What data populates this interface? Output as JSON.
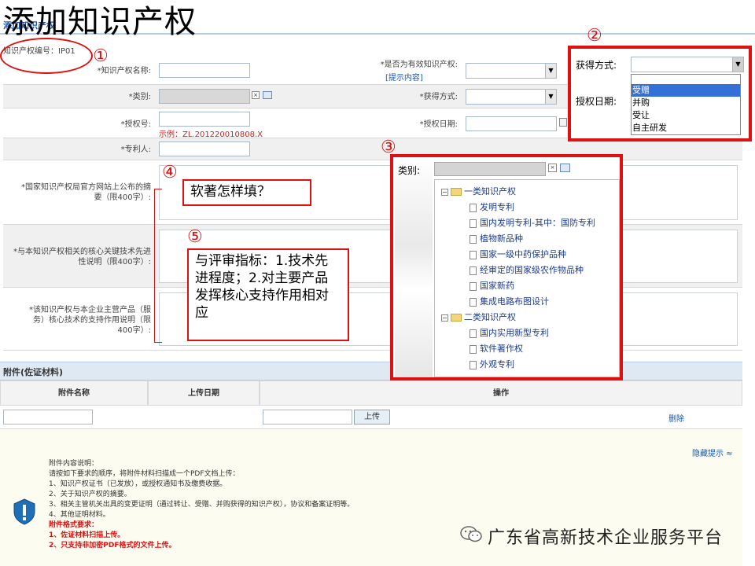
{
  "title": "添加知识产权",
  "subtitle": "添加知识产权",
  "ip_number": "知识产权编号：IP01",
  "markers": {
    "m1": "①",
    "m2": "②",
    "m3": "③",
    "m4": "④",
    "m5": "⑤"
  },
  "form": {
    "name_label": "*知识产权名称:",
    "valid_label": "*是否为有效知识产权:",
    "valid_hint": "[提示内容]",
    "category_label": "*类别:",
    "obtain_label": "*获得方式:",
    "auth_no_label": "*授权号:",
    "auth_no_example": "示例：ZL.201220010808.X",
    "auth_date_label": "*授权日期:",
    "patentee_label": "*专利人:",
    "summary_label": "*国家知识产权局官方网站上公布的摘要（限400字）:",
    "core_tech_label": "*与本知识产权相关的核心关键技术先进性说明（限400字）:",
    "support_label": "*该知识产权与本企业主营产品（服务）核心技术的支持作用说明（限400字）:"
  },
  "callouts": {
    "c4": "软著怎样填？",
    "c5": "与评审指标：1.技术先进程度；2.对主要产品发挥核心支持作用相对应"
  },
  "panel2": {
    "obtain_label": "获得方式:",
    "auth_date_label": "授权日期:",
    "options": [
      "受赠",
      "并购",
      "受让",
      "自主研发"
    ],
    "selected": "受赠"
  },
  "panel3": {
    "category_label": "类别:",
    "group1": "一类知识产权",
    "group1_items": [
      "发明专利",
      "国内发明专利-其中：国防专利",
      "植物新品种",
      "国家一级中药保护品种",
      "经审定的国家级农作物品种",
      "国家新药",
      "集成电路布图设计"
    ],
    "group2": "二类知识产权",
    "group2_items": [
      "国内实用新型专利",
      "软件著作权",
      "外观专利"
    ]
  },
  "attachments": {
    "title": "附件(佐证材料)",
    "col_name": "附件名称",
    "col_date": "上传日期",
    "col_op": "操作",
    "upload_button": "上传",
    "delete_link": "删除"
  },
  "notes": {
    "hide_tip": "隐藏提示 ≈",
    "lines": [
      "附件内容说明：",
      "请按如下要求的顺序，将附件材料扫描成一个PDF文档上传：",
      "1、知识产权证书（已发放），或授权通知书及缴费收据。",
      "2、关于知识产权的摘要。",
      "3、相关主管机关出具的变更证明（通过转让、受赠、并购获得的知识产权），协议和备案证明等。",
      "4、其他证明材料。"
    ],
    "format_title": "附件格式要求：",
    "format_lines": [
      "1、佐证材料扫描上传。",
      "2、只支持非加密PDF格式的文件上传。"
    ]
  },
  "watermark": "广东省高新技术企业服务平台",
  "colors": {
    "accent_red": "#dd1111",
    "link_blue": "#1c55a6",
    "header_blue": "#dfe9f4"
  }
}
